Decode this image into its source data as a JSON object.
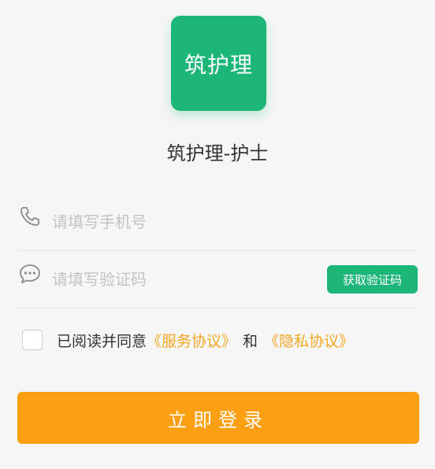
{
  "logo": {
    "text": "筑护理",
    "color": "#1db679"
  },
  "app_title": "筑护理-护士",
  "phone_field": {
    "icon": "phone-icon",
    "placeholder": "请填写手机号",
    "value": ""
  },
  "code_field": {
    "icon": "chat-bubble-icon",
    "placeholder": "请填写验证码",
    "value": "",
    "get_code_label": "获取验证码"
  },
  "agreement": {
    "checked": false,
    "prefix": "已阅读并同意",
    "service_link": "《服务协议》",
    "joiner": "和",
    "privacy_link": "《隐私协议》",
    "link_color": "#f5a623"
  },
  "login_button": {
    "label": "立即登录",
    "color": "#fc9f12"
  }
}
